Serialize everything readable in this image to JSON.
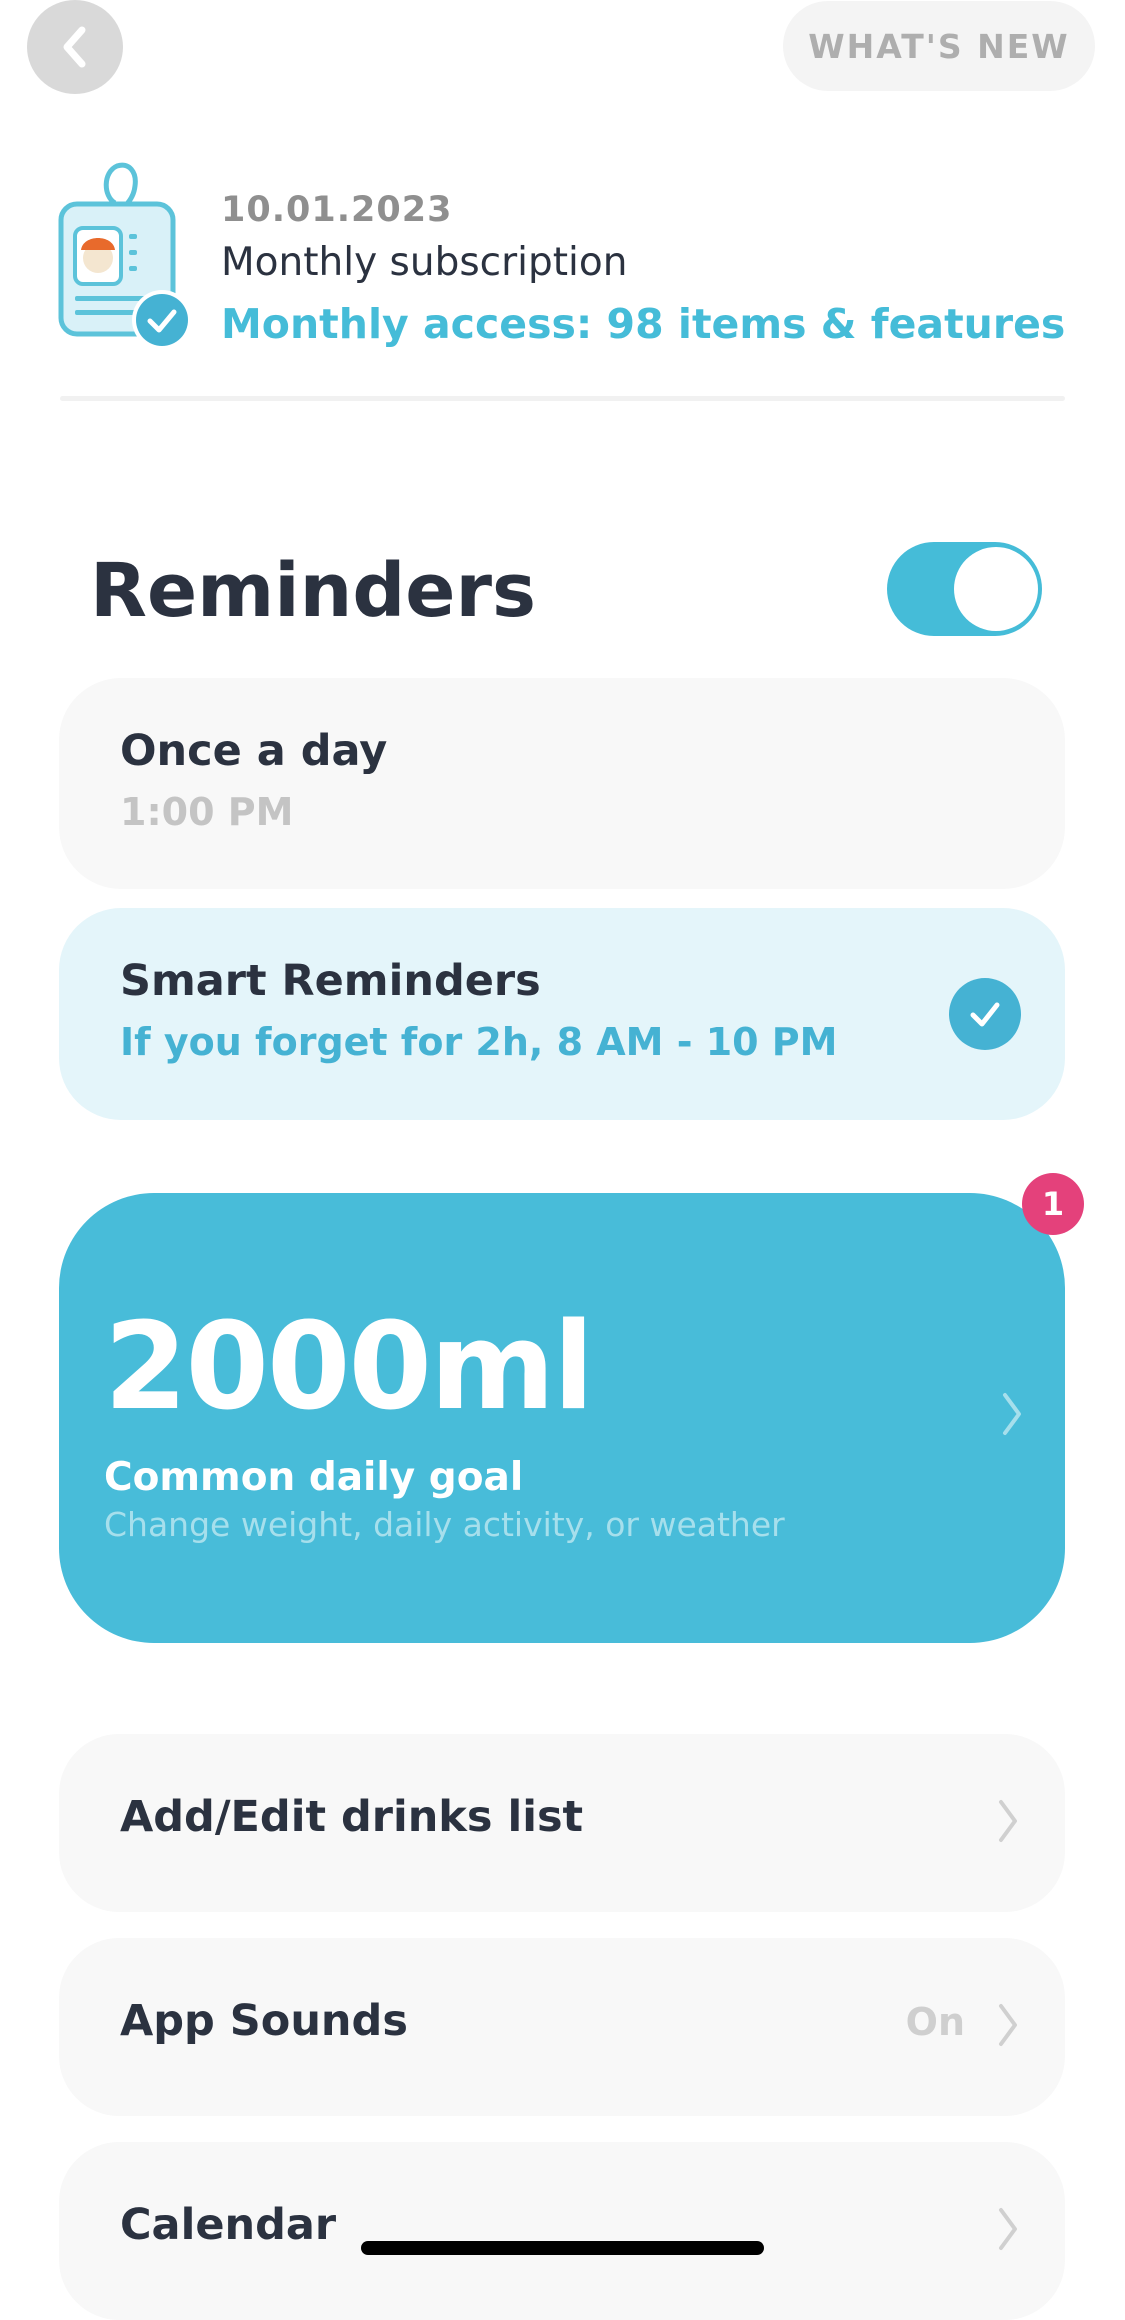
{
  "header": {
    "back_icon": "chevron-left-icon",
    "whats_new_label": "WHAT'S NEW"
  },
  "subscription": {
    "icon": "id-badge-icon",
    "date": "10.01.2023",
    "title": "Monthly subscription",
    "access": "Monthly access: 98 items & features"
  },
  "reminders": {
    "title": "Reminders",
    "enabled": true,
    "options": [
      {
        "title": "Once a day",
        "subtitle": "1:00 PM",
        "selected": false
      },
      {
        "title": "Smart Reminders",
        "subtitle": "If you forget for 2h, 8 AM - 10 PM",
        "selected": true
      }
    ]
  },
  "goal": {
    "value": "2000ml",
    "label": "Common daily goal",
    "hint": "Change weight, daily activity, or weather",
    "badge": "1"
  },
  "settings": [
    {
      "label": "Add/Edit drinks list",
      "value": ""
    },
    {
      "label": "App Sounds",
      "value": "On"
    },
    {
      "label": "Calendar",
      "value": ""
    }
  ],
  "colors": {
    "accent": "#45bcd8",
    "goal_card": "#48bcd9",
    "badge": "#e4417b",
    "selected_card": "#e4f5fa",
    "card": "#f8f8f8"
  }
}
